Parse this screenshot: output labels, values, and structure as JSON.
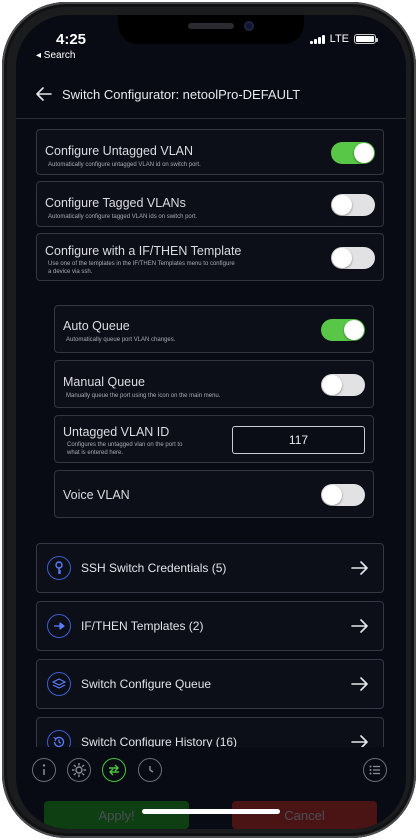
{
  "status_bar": {
    "time": "4:25",
    "back_app": "◂ Search",
    "network": "LTE"
  },
  "header": {
    "title": "Switch Configurator: netoolPro-DEFAULT"
  },
  "settings": [
    {
      "title": "Configure Untagged VLAN",
      "description": "Automatically configure untagged VLAN id on switch port.",
      "state": "on"
    },
    {
      "title": "Configure Tagged VLANs",
      "description": "Automatically configure tagged VLAN ids on switch port.",
      "state": "off"
    },
    {
      "title": "Configure with a IF/THEN Template",
      "description": "Use one of the templates in the IF/THEN Templates menu to configure a device via ssh.",
      "state": "off"
    }
  ],
  "queue_settings": {
    "auto_queue": {
      "title": "Auto Queue",
      "description": "Automatically queue port VLAN changes.",
      "state": "on"
    },
    "manual_queue": {
      "title": "Manual Queue",
      "description": "Manually queue the port using the icon on the main menu.",
      "state": "off"
    },
    "untagged_vlan_id": {
      "title": "Untagged VLAN ID",
      "description": "Configures the untagged vlan on the port to what is entered here.",
      "value": "117"
    },
    "voice_vlan": {
      "title": "Voice VLAN",
      "state": "off"
    }
  },
  "nav_items": [
    {
      "label": "SSH Switch Credentials (5)",
      "icon": "key-icon"
    },
    {
      "label": "IF/THEN Templates (2)",
      "icon": "arrow-right-circle-icon"
    },
    {
      "label": "Switch Configure Queue",
      "icon": "layers-icon"
    },
    {
      "label": "Switch Configure History (16)",
      "icon": "history-icon"
    }
  ],
  "toolbar": {
    "icons": [
      "info-icon",
      "gear-icon",
      "switch-config-icon",
      "clock-icon",
      "menu-list-icon"
    ],
    "active": "switch-config-icon"
  },
  "actions": {
    "apply_label": "Apply!",
    "cancel_label": "Cancel"
  },
  "colors": {
    "toggle_on": "#58c646",
    "accent_blue": "#3d5fd0",
    "apply_bg": "#0d3f12",
    "cancel_bg": "#4a1414"
  }
}
